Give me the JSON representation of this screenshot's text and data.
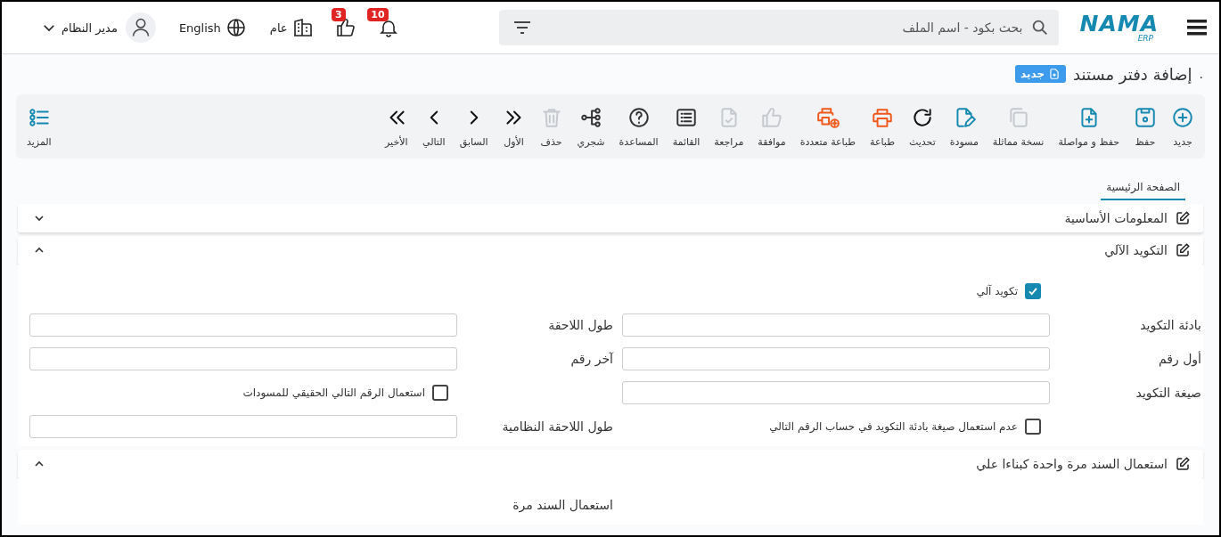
{
  "header": {
    "logo": "NAMA",
    "logo_sub": "ERP",
    "search": {
      "placeholder": "بحث بكود - اسم الملف"
    },
    "notifications": {
      "count": "10"
    },
    "likes": {
      "count": "3"
    },
    "company": "عام",
    "language": "English",
    "user": "مدير النظام"
  },
  "page_title": {
    "prefix": ".",
    "title": "إضافة دفتر مستند",
    "badge": "جديد"
  },
  "toolbar": {
    "items": [
      {
        "kind": "plus",
        "label": "جديد",
        "disabled": false
      },
      {
        "kind": "save",
        "label": "حفظ",
        "disabled": false
      },
      {
        "kind": "file-plus",
        "label": "حفظ و مواصلة",
        "disabled": false
      },
      {
        "kind": "copy",
        "label": "نسخة مماثلة",
        "disabled": true
      },
      {
        "kind": "file-edit",
        "label": "مسودة",
        "disabled": false
      },
      {
        "kind": "refresh",
        "label": "تحديث",
        "disabled": false
      },
      {
        "kind": "print",
        "label": "طباعة",
        "disabled": false
      },
      {
        "kind": "print-plus",
        "label": "طباعة متعددة",
        "disabled": false
      },
      {
        "kind": "thumb",
        "label": "موافقة",
        "disabled": true
      },
      {
        "kind": "file-check",
        "label": "مراجعة",
        "disabled": true
      },
      {
        "kind": "list",
        "label": "القائمة",
        "disabled": false
      },
      {
        "kind": "help",
        "label": "المساعدة",
        "disabled": false
      },
      {
        "kind": "tree",
        "label": "شجري",
        "disabled": false
      },
      {
        "kind": "trash",
        "label": "حذف",
        "disabled": true
      },
      {
        "kind": "first",
        "label": "الأول",
        "disabled": false
      },
      {
        "kind": "prev",
        "label": "السابق",
        "disabled": false
      },
      {
        "kind": "next",
        "label": "التالي",
        "disabled": false
      },
      {
        "kind": "last",
        "label": "الأخير",
        "disabled": false
      }
    ],
    "more": {
      "kind": "more",
      "label": "المزيد",
      "disabled": false
    }
  },
  "tabs": [
    {
      "label": "الصفحة الرئيسية",
      "selected": true
    }
  ],
  "sections": [
    {
      "title": "المعلومات الأساسية",
      "expanded": false
    },
    {
      "title": "التكويد الآلي",
      "expanded": true,
      "rows": [
        {
          "right": {
            "kind": "checkbox",
            "label": "تكويد آلي",
            "checked": true
          }
        },
        {
          "right": {
            "kind": "input",
            "label": "بادئة التكويد"
          },
          "left": {
            "kind": "input",
            "label": "طول اللاحقة"
          }
        },
        {
          "right": {
            "kind": "input",
            "label": "أول رقم"
          },
          "left": {
            "kind": "input",
            "label": "آخر رقم"
          }
        },
        {
          "right": {
            "kind": "input",
            "label": "صيغة التكويد"
          },
          "left": {
            "kind": "checkbox",
            "label": "استعمال الرقم التالي الحقيقي للمسودات",
            "checked": false
          }
        },
        {
          "right": {
            "kind": "checkbox",
            "label": "عدم استعمال صيغة بادئة التكويد في حساب الرقم التالي",
            "checked": false
          },
          "left": {
            "kind": "input",
            "label": "طول اللاحقة النظامية"
          }
        }
      ]
    },
    {
      "title": "استعمال السند مرة واحدة كبناءا علي",
      "expanded": true,
      "rows": [
        {
          "left": {
            "kind": "label",
            "label": "استعمال السند مرة"
          }
        }
      ]
    }
  ]
}
